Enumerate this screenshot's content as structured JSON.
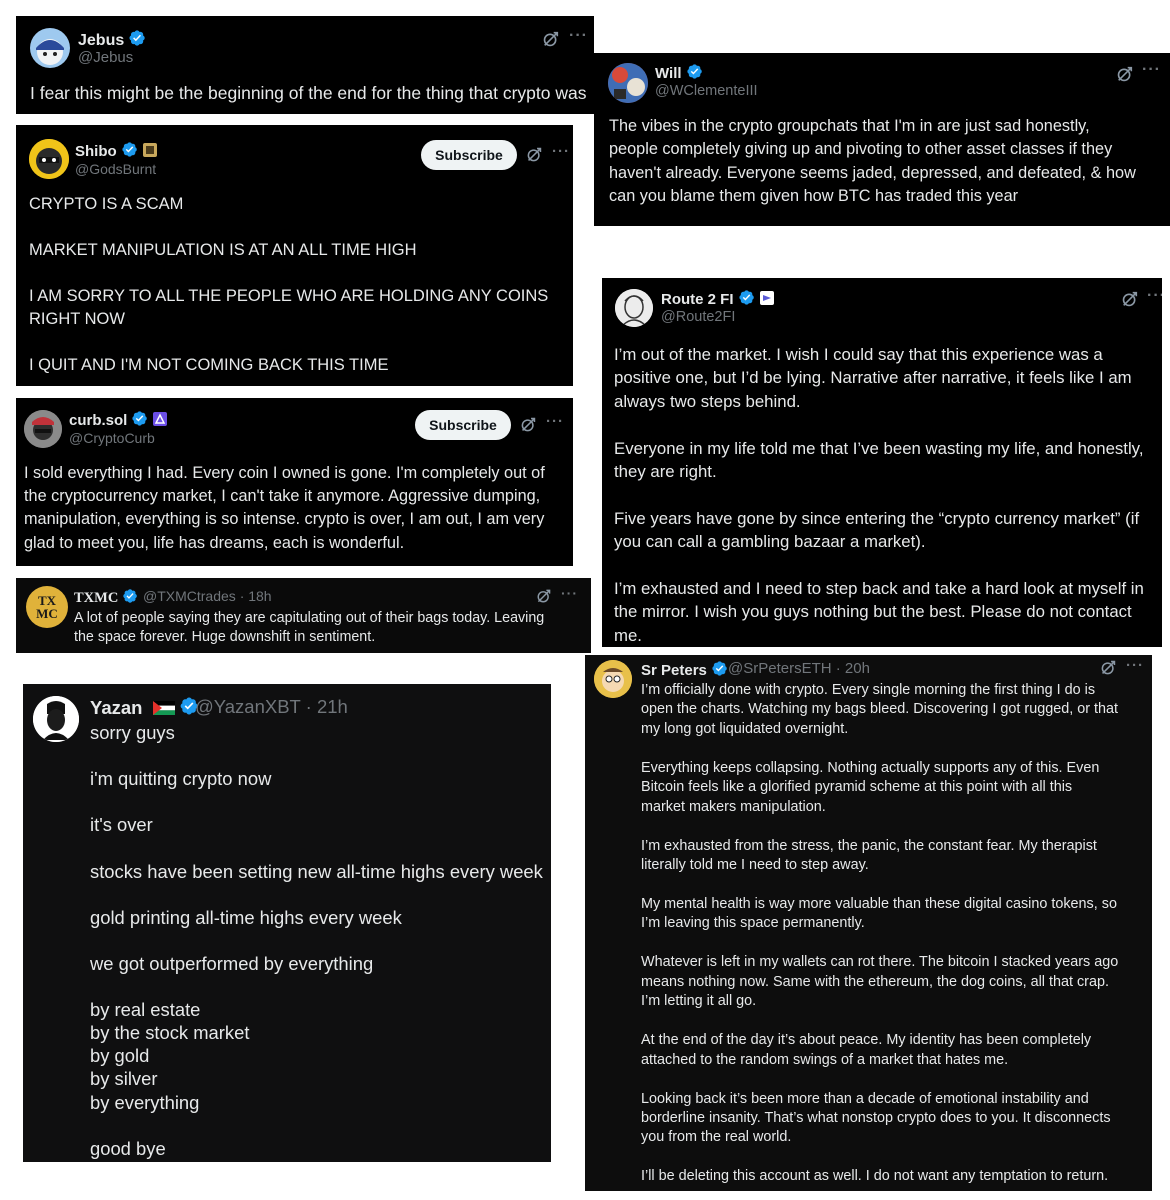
{
  "tweets": {
    "jebus": {
      "name": "Jebus",
      "handle": "@Jebus",
      "text": "I fear this might be the beginning of the end for the thing that crypto was"
    },
    "will": {
      "name": "Will",
      "handle": "@WClementeIII",
      "text": "The vibes in the crypto groupchats that I'm in are just sad honestly,\npeople completely giving up and pivoting to other asset classes if they\nhaven't already. Everyone seems jaded, depressed, and defeated, & how\ncan you blame them given how BTC has traded this year"
    },
    "shibo": {
      "name": "Shibo",
      "handle": "@GodsBurnt",
      "subscribe": "Subscribe",
      "text": "CRYPTO IS A SCAM\n\nMARKET MANIPULATION IS AT AN ALL TIME HIGH\n\nI AM SORRY TO ALL THE PEOPLE WHO ARE HOLDING ANY COINS\nRIGHT NOW\n\nI QUIT AND I'M NOT COMING BACK THIS TIME"
    },
    "route2fi": {
      "name": "Route 2 FI",
      "handle": "@Route2FI",
      "text": "I’m out of the market. I wish I could say that this experience was a\npositive one, but I’d be lying. Narrative after narrative, it feels like I am\nalways two steps behind.\n\nEveryone in my life told me that I’ve been wasting my life, and honestly,\nthey are right.\n\nFive years have gone by since entering the “crypto currency market” (if\nyou can call a gambling bazaar a market).\n\nI’m exhausted and I need to step back and take a hard look at myself in\nthe mirror. I wish you guys nothing but the best. Please do not contact\nme."
    },
    "curb": {
      "name": "curb.sol",
      "handle": "@CryptoCurb",
      "subscribe": "Subscribe",
      "text": "I sold everything I had. Every coin I owned is gone. I'm completely out of\nthe cryptocurrency market, I can't take it anymore. Aggressive dumping,\nmanipulation, everything is so intense. crypto is over, I am out, I am very\nglad to meet you, life has dreams, each is wonderful."
    },
    "txmc": {
      "name": "TXMC",
      "handle": "@TXMCtrades",
      "time": "· 18h",
      "text": "A lot of people saying they are capitulating out of their bags today. Leaving\nthe space forever. Huge downshift in sentiment.",
      "avatar_text": "TX\nMC"
    },
    "yazan": {
      "name": "Yazan",
      "handle": "@YazanXBT",
      "time": "· 21h",
      "text": "sorry guys\n\ni'm quitting crypto now\n\nit's over\n\nstocks have been setting new all-time highs every week\n\ngold printing all-time highs every week\n\nwe got outperformed by everything\n\nby real estate\nby the stock market\nby gold\nby silver\nby everything\n\ngood bye"
    },
    "srpeters": {
      "name": "Sr Peters",
      "handle": "@SrPetersETH",
      "time": "· 20h",
      "text": "I’m officially done with crypto. Every single morning the first thing I do is\nopen the charts. Watching my bags bleed. Discovering I got rugged, or that\nmy long got liquidated overnight.\n\nEverything keeps collapsing. Nothing actually supports any of this. Even\nBitcoin feels like a glorified pyramid scheme at this point with all this\nmarket makers manipulation.\n\nI’m exhausted from the stress, the panic, the constant fear. My therapist\nliterally told me I need to step away.\n\nMy mental health is way more valuable than these digital casino tokens, so\nI’m leaving this space permanently.\n\nWhatever is left in my wallets can rot there. The bitcoin I stacked years ago\nmeans nothing now. Same with the ethereum, the dog coins, all that crap.\nI’m letting it all go.\n\nAt the end of the day it’s about peace. My identity has been completely\nattached to the random swings of a market that hates me.\n\nLooking back it’s been more than a decade of emotional instability and\nborderline insanity. That’s what nonstop crypto does to you. It disconnects\nyou from the real world.\n\nI’ll be deleting this account as well. I do not want any temptation to return."
    }
  },
  "more_label": "···",
  "colors": {
    "card_bg": "#000000",
    "text": "#e7e9ea",
    "muted": "#71767b",
    "verified": "#1d9bf0"
  }
}
